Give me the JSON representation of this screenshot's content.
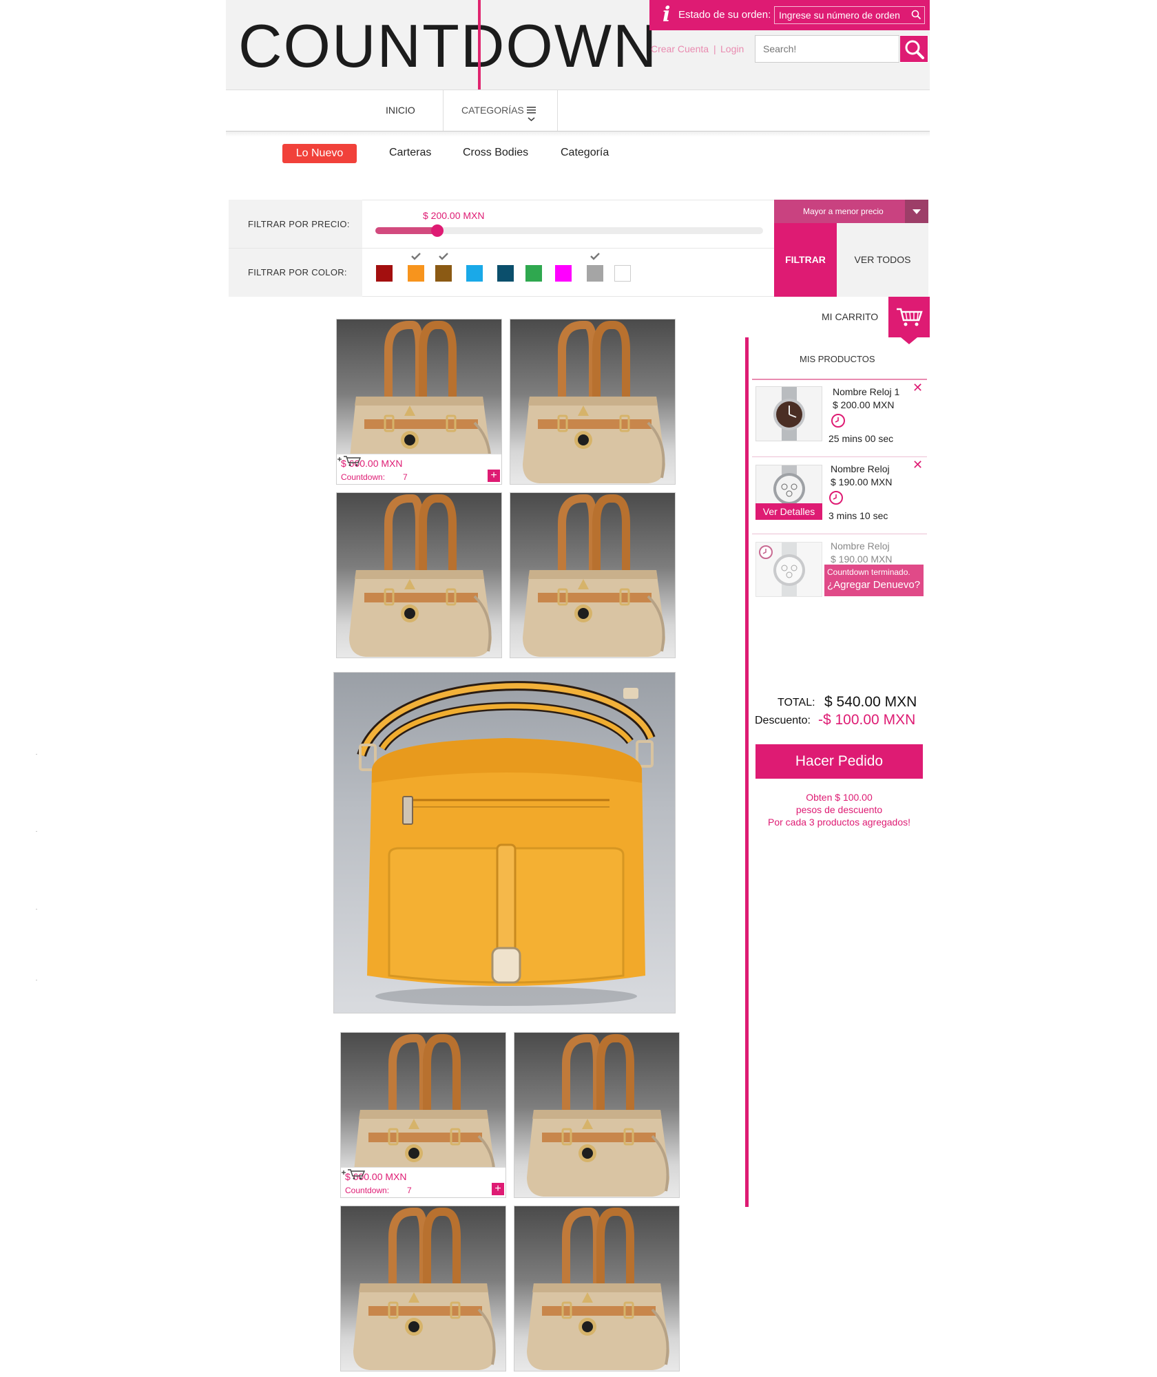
{
  "brand": {
    "logo_text": "COUNTDOWN",
    "accent_color": "#de1b73",
    "sale_color": "#f1413a"
  },
  "header": {
    "order_info_icon": "i",
    "order_status_label": "Estado de su orden:",
    "order_input_placeholder": "Ingrese su número de orden",
    "create_account": "Crear Cuenta",
    "separator": "|",
    "login": "Login",
    "search_placeholder": "Search!"
  },
  "nav": {
    "home": "INICIO",
    "categories": "CATEGORÍAS"
  },
  "subnav": {
    "items": [
      "Lo Nuevo",
      "Carteras",
      "Cross Bodies",
      "Categoría"
    ],
    "active": "Lo Nuevo"
  },
  "filter": {
    "price_label": "FILTRAR POR PRECIO:",
    "price_value": "$ 200.00 MXN",
    "price_fraction": 0.16,
    "color_label": "FILTRAR POR COLOR:",
    "colors": [
      {
        "hex": "#a30f0f",
        "checked": false
      },
      {
        "hex": "#f7941d",
        "checked": true
      },
      {
        "hex": "#8b5a14",
        "checked": true
      },
      {
        "hex": "#1aa9e8",
        "checked": false
      },
      {
        "hex": "#0b4f6c",
        "checked": false
      },
      {
        "hex": "#2fa84f",
        "checked": false
      },
      {
        "hex": "#ff00ff",
        "checked": false
      },
      {
        "hex": "#a5a5a5",
        "checked": true
      },
      {
        "hex": "#ffffff",
        "checked": false
      }
    ],
    "sort_label": "Mayor a menor precio",
    "filter_button": "FILTRAR",
    "view_all_button": "VER TODOS"
  },
  "product_card": {
    "price": "$ 600.00 MXN",
    "countdown_label": "Countdown:",
    "countdown_value": "7",
    "plus": "+"
  },
  "cart": {
    "title": "MI CARRITO",
    "section_title": "MIS PRODUCTOS",
    "items": [
      {
        "name": "Nombre Reloj 1",
        "price": "$ 200.00 MXN",
        "time": "25 mins 00 sec",
        "remove": "✕"
      },
      {
        "name": "Nombre Reloj",
        "price": "$ 190.00 MXN",
        "time": "3 mins 10 sec",
        "remove": "✕",
        "details_button": "Ver Detalles"
      },
      {
        "name": "Nombre Reloj",
        "price": "$ 190.00 MXN",
        "ended_line1": "Countdown terminado.",
        "ended_line2": "¿Agregar Denuevo?"
      }
    ],
    "total_label": "TOTAL:",
    "total_value": "$ 540.00 MXN",
    "discount_label": "Descuento:",
    "discount_value": "-$ 100.00 MXN",
    "order_button": "Hacer Pedido",
    "promo_line1": "Obten $ 100.00",
    "promo_line2": "pesos de descuento",
    "promo_line3": "Por cada 3 productos agregados!"
  }
}
